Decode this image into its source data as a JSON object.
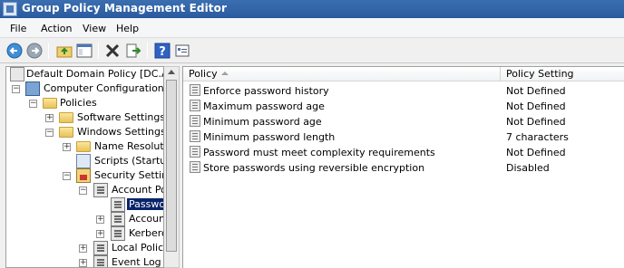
{
  "window": {
    "title": "Group Policy Management Editor"
  },
  "menu": {
    "items": [
      {
        "label": "File"
      },
      {
        "label": "Action"
      },
      {
        "label": "View"
      },
      {
        "label": "Help"
      }
    ]
  },
  "toolbar": {
    "buttons": [
      {
        "icon": "back-arrow-icon"
      },
      {
        "icon": "forward-arrow-icon"
      },
      {
        "icon": "up-folder-icon"
      },
      {
        "icon": "show-hide-console-tree-icon"
      },
      {
        "icon": "delete-icon"
      },
      {
        "icon": "export-list-icon"
      },
      {
        "icon": "help-icon"
      },
      {
        "icon": "properties-icon"
      }
    ]
  },
  "tree": {
    "nodes": [
      {
        "label": "Default Domain Policy [DC.ARE/",
        "expander": "",
        "icon": "domain-policy-icon"
      },
      {
        "label": "Computer Configuration",
        "expander": "−",
        "icon": "computer-icon"
      },
      {
        "label": "Policies",
        "expander": "−",
        "icon": "folder-icon"
      },
      {
        "label": "Software Settings",
        "expander": "+",
        "icon": "folder-icon"
      },
      {
        "label": "Windows Settings",
        "expander": "−",
        "icon": "folder-icon"
      },
      {
        "label": "Name Resolutio",
        "expander": "+",
        "icon": "folder-icon"
      },
      {
        "label": "Scripts (Startup",
        "expander": "",
        "icon": "scripts-icon"
      },
      {
        "label": "Security Setting",
        "expander": "−",
        "icon": "security-settings-icon"
      },
      {
        "label": "Account Pol",
        "expander": "−",
        "icon": "policy-icon"
      },
      {
        "label": "Passwo",
        "expander": "",
        "icon": "policy-icon",
        "selected": true
      },
      {
        "label": "Account",
        "expander": "+",
        "icon": "policy-icon"
      },
      {
        "label": "Kerbero",
        "expander": "+",
        "icon": "policy-icon"
      },
      {
        "label": "Local Policie",
        "expander": "+",
        "icon": "policy-icon"
      },
      {
        "label": "Event Log",
        "expander": "+",
        "icon": "policy-icon"
      }
    ]
  },
  "list": {
    "columns": {
      "policy": "Policy",
      "setting": "Policy Setting"
    },
    "rows": [
      {
        "policy": "Enforce password history",
        "setting": "Not Defined"
      },
      {
        "policy": "Maximum password age",
        "setting": "Not Defined"
      },
      {
        "policy": "Minimum password age",
        "setting": "Not Defined"
      },
      {
        "policy": "Minimum password length",
        "setting": "7 characters"
      },
      {
        "policy": "Password must meet complexity requirements",
        "setting": "Not Defined"
      },
      {
        "policy": "Store passwords using reversible encryption",
        "setting": "Disabled"
      }
    ]
  }
}
